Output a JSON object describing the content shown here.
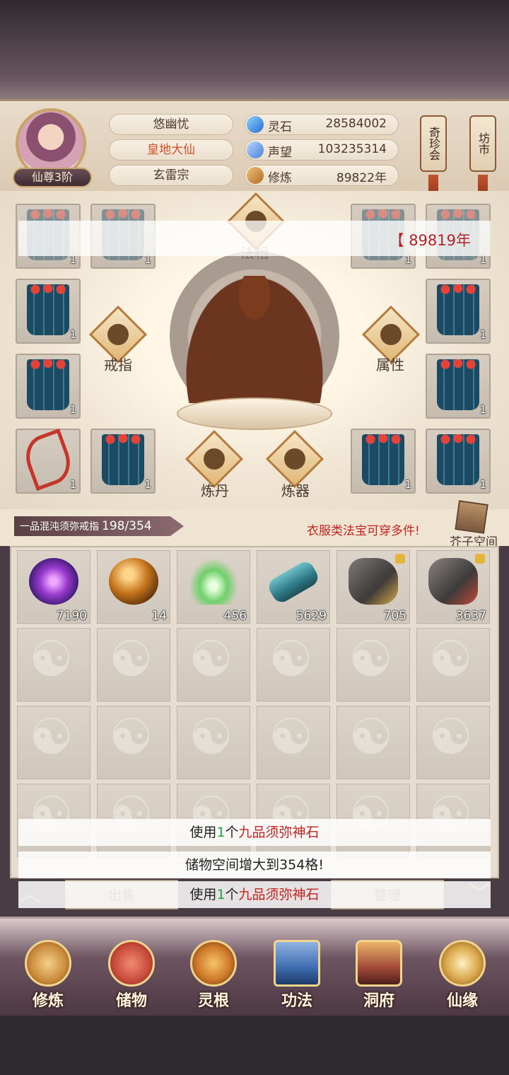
{
  "header": {
    "rank": "仙尊3阶",
    "player_name": "悠幽忧",
    "realm": "皇地大仙",
    "sect": "玄雷宗",
    "resources": [
      {
        "name": "灵石",
        "value": "28584002",
        "icon": "gem-icon",
        "color": "#3a8fe0"
      },
      {
        "name": "声望",
        "value": "103235314",
        "icon": "crystal-icon",
        "color": "#4b7fd8"
      },
      {
        "name": "修炼",
        "value": "89822年",
        "icon": "meditate-icon",
        "color": "#c6822d"
      }
    ],
    "side_buttons": [
      "奇珍会",
      "坊市"
    ]
  },
  "equip": {
    "overlay_value": "【 89819年",
    "features": {
      "fa_xiang": "法相",
      "ring": "戒指",
      "attribute": "属性",
      "alchemy": "炼丹",
      "forge": "炼器"
    },
    "slots": [
      {
        "count": "1",
        "item": "robe"
      },
      {
        "count": "1",
        "item": "robe"
      },
      {
        "count": "1",
        "item": "robe"
      },
      {
        "count": "1",
        "item": "robe"
      },
      {
        "count": "1",
        "item": "robe"
      },
      {
        "count": "1",
        "item": "robe"
      },
      {
        "count": "1",
        "item": "robe"
      },
      {
        "count": "1",
        "item": "robe"
      },
      {
        "count": "1",
        "item": "bow"
      },
      {
        "count": "1",
        "item": "robe"
      },
      {
        "count": "1",
        "item": "robe"
      },
      {
        "count": "1",
        "item": "robe"
      }
    ]
  },
  "bag": {
    "ring_name": "一品混沌须弥戒指",
    "capacity": "198/354",
    "hint": "衣服类法宝可穿多件!",
    "mustard_label": "芥子空间",
    "items": [
      {
        "count": "7190",
        "icon": "purple-orb-icon",
        "locked": false
      },
      {
        "count": "14",
        "icon": "amber-orb-icon",
        "locked": false
      },
      {
        "count": "456",
        "icon": "jade-herb-icon",
        "locked": false
      },
      {
        "count": "5629",
        "icon": "scroll-icon",
        "locked": false
      },
      {
        "count": "705",
        "icon": "ore-icon",
        "locked": true
      },
      {
        "count": "3637",
        "icon": "ore-red-icon",
        "locked": true
      }
    ]
  },
  "toasts": [
    {
      "prefix": "使用",
      "num": "1",
      "mid": "个",
      "item": "九品须弥神石",
      "suffix": ""
    },
    {
      "prefix": "储物空间增大到354格!",
      "num": "",
      "mid": "",
      "item": "",
      "suffix": ""
    },
    {
      "prefix": "使用",
      "num": "1",
      "mid": "个",
      "item": "九品须弥神石",
      "suffix": ""
    }
  ],
  "actions": {
    "sell": "出售",
    "sort": "整理"
  },
  "nav": [
    {
      "label": "修炼",
      "icon": "cultivate-icon",
      "color": "#c98a3a"
    },
    {
      "label": "储物",
      "icon": "pouch-icon",
      "color": "#c64a3a"
    },
    {
      "label": "灵根",
      "icon": "spirit-root-icon",
      "color": "#d07a2a"
    },
    {
      "label": "功法",
      "icon": "book-icon",
      "color": "#3e6db0"
    },
    {
      "label": "洞府",
      "icon": "palace-icon",
      "color": "#a34a3a"
    },
    {
      "label": "仙缘",
      "icon": "gourd-icon",
      "color": "#d9a64a"
    }
  ]
}
